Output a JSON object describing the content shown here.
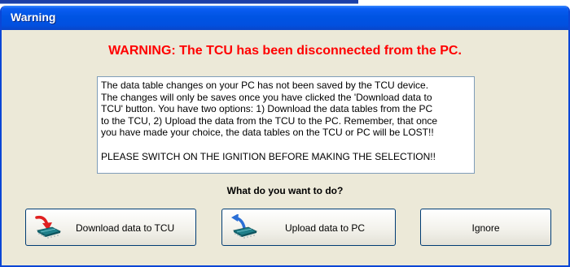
{
  "window": {
    "title": "Warning"
  },
  "headline": "WARNING: The TCU has been disconnected from the PC.",
  "message": {
    "body": "The data table changes on your PC has not been saved by the TCU device.\nThe changes will only be saves once you have clicked the 'Download data to\nTCU' button. You have two options: 1) Download the data tables from the PC\nto the TCU, 2) Upload the data from the TCU to the PC. Remember, that once\nyou have made your choice, the data tables on the TCU or PC will be LOST!!",
    "ignition_notice": "PLEASE SWITCH ON THE IGNITION BEFORE MAKING THE SELECTION!!"
  },
  "question": "What do you want to do?",
  "buttons": {
    "download": "Download data to TCU",
    "upload": "Upload data to PC",
    "ignore": "Ignore"
  },
  "icons": {
    "download": "download-to-chip-icon",
    "upload": "upload-from-chip-icon"
  },
  "colors": {
    "titlebar": "#0054e3",
    "warning_text": "#ff0000",
    "dialog_background": "#ece9d8",
    "download_arrow": "#e02020",
    "upload_arrow": "#2b6fd6",
    "chip": "#1f7f8a"
  }
}
